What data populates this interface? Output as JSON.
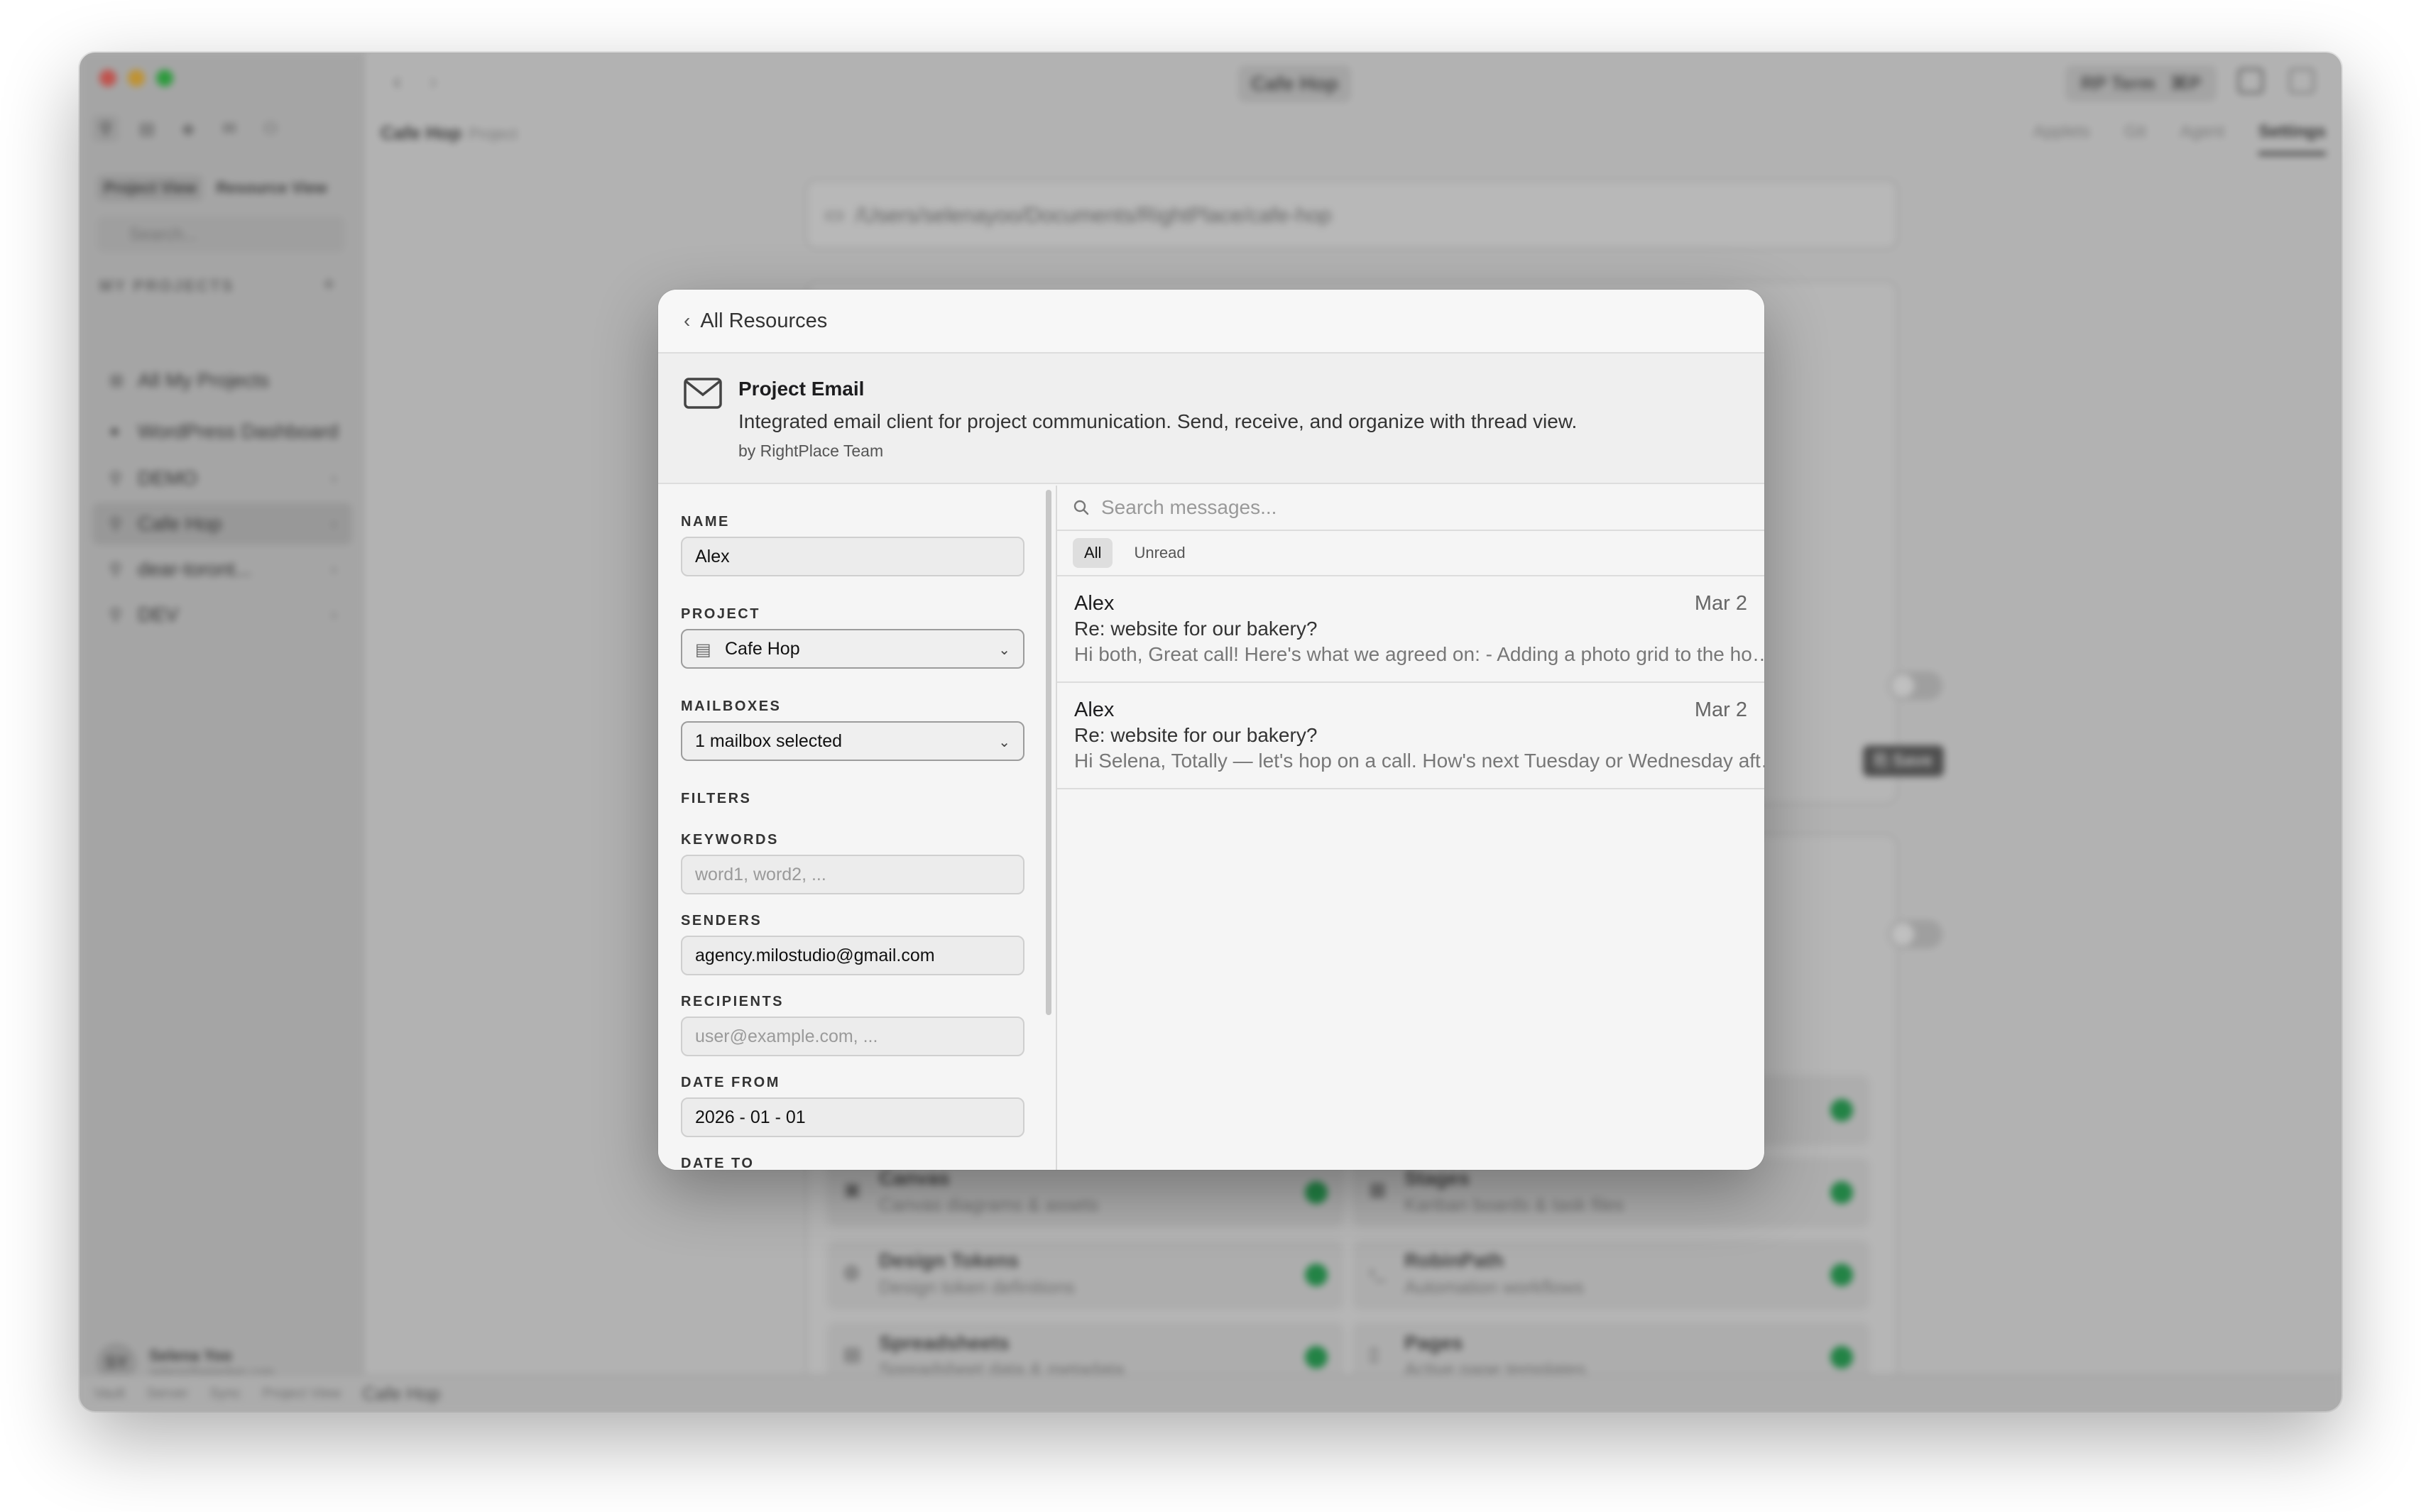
{
  "window": {
    "title": "Cafe Hop",
    "term_label": "RP Term",
    "term_shortcut": "⌘P"
  },
  "sidebar": {
    "view_tabs": [
      "Project View",
      "Resource View"
    ],
    "search_placeholder": "Search...",
    "section_title": "MY PROJECTS",
    "items": [
      {
        "label": "All My Projects"
      },
      {
        "label": "WordPress Dashboard"
      },
      {
        "label": "DEMO"
      },
      {
        "label": "Cafe Hop"
      },
      {
        "label": "dear-toront..."
      },
      {
        "label": "DEV"
      }
    ],
    "user": {
      "initials": "SY",
      "name": "Selena Yoo",
      "email": "selena@wiredwp.com"
    }
  },
  "main": {
    "breadcrumb": "Cafe Hop",
    "breadcrumb_type": "Project",
    "tabs": [
      "Applets",
      "Git",
      "Agent",
      "Settings"
    ],
    "path": "/Users/selenayoo/Documents/RightPlace/cafe-hop",
    "save_label": "Save",
    "resources": [
      {
        "title": "Canvas",
        "desc": "Canvas diagrams & assets"
      },
      {
        "title": "Stages",
        "desc": "Kanban boards & task files"
      },
      {
        "title": "Design Tokens",
        "desc": "Design token definitions"
      },
      {
        "title": "RobinPath",
        "desc": "Automation workflows"
      },
      {
        "title": "Spreadsheets",
        "desc": "Spreadsheet data & metadata"
      },
      {
        "title": "Pages",
        "desc": "Active page templates"
      }
    ],
    "status": [
      "Vault",
      "Server",
      "Sync",
      "Project View",
      "Cafe Hop"
    ]
  },
  "modal": {
    "back_label": "All Resources",
    "title": "Project Email",
    "description": "Integrated email client for project communication. Send, receive, and organize with thread view.",
    "author": "by RightPlace Team",
    "form": {
      "name_label": "NAME",
      "name_value": "Alex",
      "project_label": "PROJECT",
      "project_value": "Cafe Hop",
      "mailboxes_label": "MAILBOXES",
      "mailboxes_value": "1 mailbox selected",
      "filters_label": "FILTERS",
      "keywords_label": "KEYWORDS",
      "keywords_placeholder": "word1, word2, ...",
      "senders_label": "SENDERS",
      "senders_value": "agency.milostudio@gmail.com",
      "recipients_label": "RECIPIENTS",
      "recipients_placeholder": "user@example.com, ...",
      "date_from_label": "DATE FROM",
      "date_from_value": "2026 - 01 - 01",
      "date_to_label": "DATE TO"
    },
    "search_placeholder": "Search messages...",
    "filter_tabs": [
      "All",
      "Unread"
    ],
    "messages": [
      {
        "from": "Alex",
        "date": "Mar 2",
        "subject": "Re: website for our bakery?",
        "preview": "Hi both, Great call! Here's what we agreed on: - Adding a photo grid to the homepage"
      },
      {
        "from": "Alex",
        "date": "Mar 2",
        "subject": "Re: website for our bakery?",
        "preview": "Hi Selena, Totally — let's hop on a call. How's next Tuesday or Wednesday afternoon?"
      }
    ]
  }
}
